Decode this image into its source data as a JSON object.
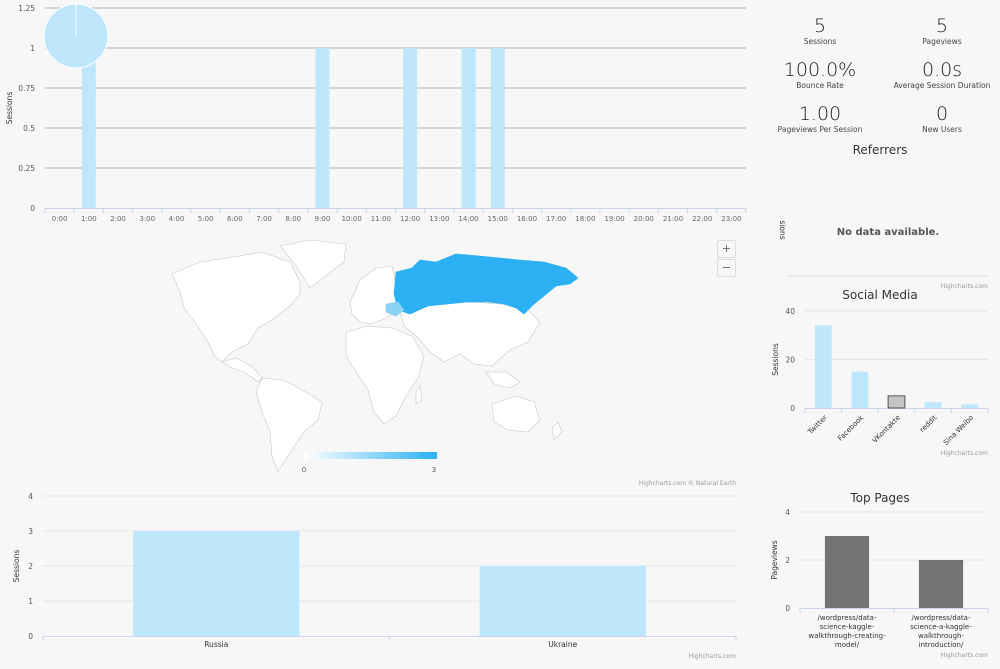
{
  "colors": {
    "bar_light_blue": "#bfe7fb",
    "map_high": "#2ab0f3",
    "map_mid": "#8bd2f7",
    "bar_dark_gray": "#737373",
    "bar_gray_highlight": "#c4c4c4",
    "grid": "#cfcfcf"
  },
  "hourly_chart": {
    "chart_data": {
      "type": "bar",
      "title": "",
      "xlabel": "",
      "ylabel": "Sessions",
      "ylim": [
        0,
        1.25
      ],
      "yticks": [
        "0",
        "0.25",
        "0.5",
        "0.75",
        "1",
        "1.25"
      ],
      "categories": [
        "0:00",
        "1:00",
        "2:00",
        "3:00",
        "4:00",
        "5:00",
        "6:00",
        "7:00",
        "8:00",
        "9:00",
        "10:00",
        "11:00",
        "12:00",
        "13:00",
        "14:00",
        "15:00",
        "16:00",
        "17:00",
        "18:00",
        "19:00",
        "20:00",
        "21:00",
        "22:00",
        "23:00"
      ],
      "values": [
        0,
        1,
        0,
        0,
        0,
        0,
        0,
        0,
        0,
        1,
        0,
        0,
        1,
        0,
        1,
        1,
        0,
        0,
        0,
        0,
        0,
        0,
        0,
        0
      ],
      "grid": true
    },
    "overlay_pie": {
      "slices": [
        1
      ],
      "note": "single-slice pie overlay"
    }
  },
  "stats": [
    {
      "value": "5",
      "label": "Sessions"
    },
    {
      "value": "5",
      "label": "Pageviews"
    },
    {
      "value": "100.0%",
      "label": "Bounce Rate"
    },
    {
      "value": "0.0s",
      "label": "Average Session Duration"
    },
    {
      "value": "1.00",
      "label": "Pageviews Per Session"
    },
    {
      "value": "0",
      "label": "New Users"
    }
  ],
  "referrers": {
    "title": "Referrers",
    "ylabel": "sions",
    "no_data": "No data available.",
    "credit": "Highcharts.com"
  },
  "map": {
    "zoom_in": "+",
    "zoom_out": "−",
    "legend_min": "0",
    "legend_max": "3",
    "credit": "Highcharts.com © Natural Earth",
    "chart_data": {
      "type": "heatmap",
      "title": "",
      "regions": [
        {
          "name": "Russia",
          "value": 3
        },
        {
          "name": "Ukraine",
          "value": 2
        }
      ],
      "color_range": [
        0,
        3
      ]
    }
  },
  "country_chart": {
    "credit": "Highcharts.com",
    "chart_data": {
      "type": "bar",
      "title": "",
      "xlabel": "",
      "ylabel": "Sessions",
      "ylim": [
        0,
        4
      ],
      "yticks": [
        "0",
        "1",
        "2",
        "3",
        "4"
      ],
      "categories": [
        "Russia",
        "Ukraine"
      ],
      "values": [
        3,
        2
      ],
      "grid": true
    }
  },
  "social_chart": {
    "credit": "Highcharts.com",
    "chart_data": {
      "type": "bar",
      "title": "Social Media",
      "xlabel": "",
      "ylabel": "Sessions",
      "ylim": [
        0,
        40
      ],
      "yticks": [
        "0",
        "20",
        "40"
      ],
      "categories": [
        "Twitter",
        "Facebook",
        "VKontakte",
        "reddit",
        "Sina Weibo"
      ],
      "values": [
        34,
        15,
        5,
        2.5,
        1.5
      ],
      "highlighted": "VKontakte",
      "grid": true
    }
  },
  "top_pages_chart": {
    "credit": "Highcharts.com",
    "chart_data": {
      "type": "bar",
      "title": "Top Pages",
      "xlabel": "",
      "ylabel": "Pageviews",
      "ylim": [
        0,
        4
      ],
      "yticks": [
        "0",
        "2",
        "4"
      ],
      "categories": [
        [
          "/wordpress/data-",
          "science-kaggle-",
          "walkthrough-creating-",
          "model/"
        ],
        [
          "/wordpress/data-",
          "science-a-kaggle-",
          "walkthrough-",
          "introduction/"
        ]
      ],
      "values": [
        3,
        2
      ],
      "grid": true
    }
  }
}
